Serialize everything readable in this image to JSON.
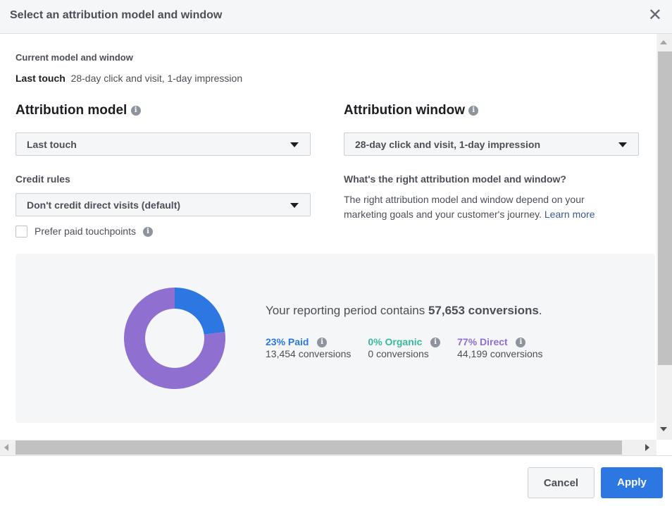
{
  "dialog": {
    "title": "Select an attribution model and window",
    "close": "✕"
  },
  "current": {
    "label": "Current model and window",
    "model": "Last touch",
    "window": "28-day click and visit, 1-day impression"
  },
  "model": {
    "heading": "Attribution model",
    "selected": "Last touch"
  },
  "credit": {
    "label": "Credit rules",
    "selected": "Don't credit direct visits (default)",
    "checkbox_label": "Prefer paid touchpoints",
    "checked": false
  },
  "window": {
    "heading": "Attribution window",
    "selected": "28-day click and visit, 1-day impression"
  },
  "help": {
    "question": "What's the right attribution model and window?",
    "text": "The right attribution model and window depend on your marketing goals and your customer's journey.",
    "link": "Learn more"
  },
  "summary": {
    "prefix": "Your reporting period contains",
    "total": "57,653 conversions",
    "suffix": "."
  },
  "breakdown": [
    {
      "label": "23% Paid",
      "count": "13,454 conversions",
      "percent": 23,
      "color": "#2d77e3"
    },
    {
      "label": "0% Organic",
      "count": "0 conversions",
      "percent": 0,
      "color": "#3ab99b"
    },
    {
      "label": "77% Direct",
      "count": "44,199 conversions",
      "percent": 77,
      "color": "#8f6fd0"
    }
  ],
  "footer": {
    "cancel": "Cancel",
    "apply": "Apply",
    "accent": "#2d77e3"
  }
}
